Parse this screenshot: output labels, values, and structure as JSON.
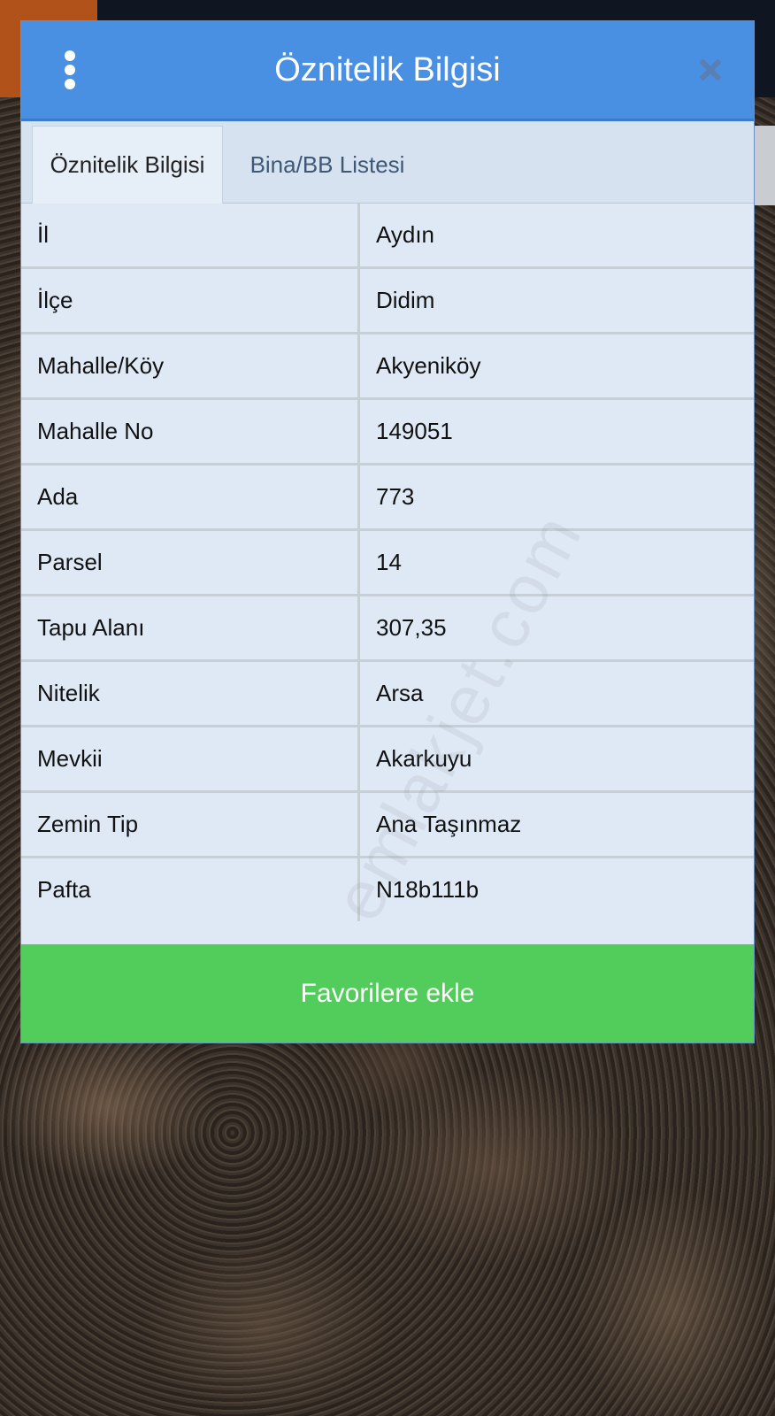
{
  "dialog": {
    "title": "Öznitelik Bilgisi",
    "menu_icon": "vertical-dots-icon",
    "close_icon": "close-icon"
  },
  "tabs": [
    {
      "label": "Öznitelik Bilgisi",
      "active": true
    },
    {
      "label": "Bina/BB Listesi",
      "active": false
    }
  ],
  "attributes": [
    {
      "key": "İl",
      "value": "Aydın"
    },
    {
      "key": "İlçe",
      "value": "Didim"
    },
    {
      "key": "Mahalle/Köy",
      "value": "Akyeniköy"
    },
    {
      "key": "Mahalle No",
      "value": "149051"
    },
    {
      "key": "Ada",
      "value": "773"
    },
    {
      "key": "Parsel",
      "value": "14"
    },
    {
      "key": "Tapu Alanı",
      "value": "307,35"
    },
    {
      "key": "Nitelik",
      "value": "Arsa"
    },
    {
      "key": "Mevkii",
      "value": "Akarkuyu"
    },
    {
      "key": "Zemin Tip",
      "value": "Ana Taşınmaz"
    },
    {
      "key": "Pafta",
      "value": "N18b111b"
    }
  ],
  "actions": {
    "favorite_label": "Favorilere ekle"
  },
  "watermark": "emlakjet.com",
  "colors": {
    "header": "#4a90e2",
    "button": "#52cc5a",
    "panel": "#dfe9f5"
  }
}
